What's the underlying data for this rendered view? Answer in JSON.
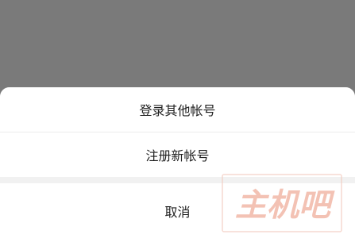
{
  "action_sheet": {
    "options": [
      {
        "label": "登录其他帐号"
      },
      {
        "label": "注册新帐号"
      }
    ],
    "cancel_label": "取消"
  },
  "watermark": {
    "text": "主机吧",
    "color": "#f2b8a7"
  },
  "colors": {
    "overlay": "#7a7a7a",
    "sheet_background": "#ffffff",
    "text": "#1f1f1f",
    "divider": "#ececec",
    "gap": "#f1f1f1"
  }
}
